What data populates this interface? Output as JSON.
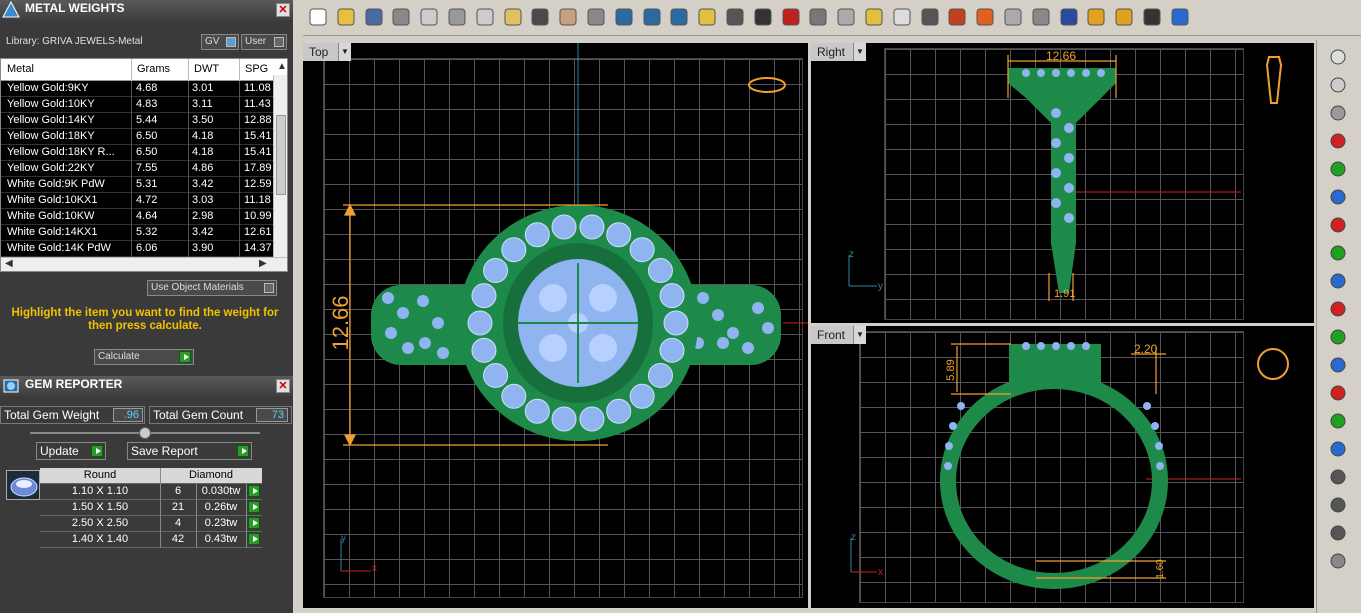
{
  "metal_weights": {
    "title": "METAL WEIGHTS",
    "library": "Library: GRIVA JEWELS-Metal",
    "gv_label": "GV",
    "user_label": "User",
    "columns": [
      "Metal",
      "Grams",
      "DWT",
      "SPG"
    ],
    "rows": [
      [
        "Yellow Gold:9KY",
        "4.68",
        "3.01",
        "11.08"
      ],
      [
        "Yellow Gold:10KY",
        "4.83",
        "3.11",
        "11.43"
      ],
      [
        "Yellow Gold:14KY",
        "5.44",
        "3.50",
        "12.88"
      ],
      [
        "Yellow Gold:18KY",
        "6.50",
        "4.18",
        "15.41"
      ],
      [
        "Yellow Gold:18KY R...",
        "6.50",
        "4.18",
        "15.41"
      ],
      [
        "Yellow Gold:22KY",
        "7.55",
        "4.86",
        "17.89"
      ],
      [
        "White Gold:9K PdW",
        "5.31",
        "3.42",
        "12.59"
      ],
      [
        "White Gold:10KX1",
        "4.72",
        "3.03",
        "11.18"
      ],
      [
        "White Gold:10KW",
        "4.64",
        "2.98",
        "10.99"
      ],
      [
        "White Gold:14KX1",
        "5.32",
        "3.42",
        "12.61"
      ],
      [
        "White Gold:14K PdW",
        "6.06",
        "3.90",
        "14.37"
      ]
    ],
    "use_object_materials": "Use Object Materials",
    "hint": "Highlight the item you want to find the weight for then press calculate.",
    "calculate_label": "Calculate"
  },
  "gem_reporter": {
    "title": "GEM REPORTER",
    "total_weight_label": "Total Gem Weight",
    "total_weight_value": ".96",
    "total_count_label": "Total Gem Count",
    "total_count_value": "73",
    "update_label": "Update",
    "save_report_label": "Save Report",
    "shape_header": "Round",
    "material_header": "Diamond",
    "rows": [
      [
        "1.10 X 1.10",
        "6",
        "0.030tw"
      ],
      [
        "1.50 X 1.50",
        "21",
        "0.26tw"
      ],
      [
        "2.50 X 2.50",
        "4",
        "0.23tw"
      ],
      [
        "1.40 X 1.40",
        "42",
        "0.43tw"
      ]
    ]
  },
  "viewports": {
    "top": {
      "label": "Top",
      "dimension": "12.66",
      "axis_v": "y",
      "axis_h": "x"
    },
    "right": {
      "label": "Right",
      "dimension_top": "12.66",
      "dimension_bottom": "1.91",
      "axis_v": "z",
      "axis_h": "y"
    },
    "front": {
      "label": "Front",
      "dimension_left": "5.89",
      "dimension_right": "2.20",
      "dimension_bottom": "1.60",
      "axis_v": "z",
      "axis_h": "x"
    }
  },
  "colors": {
    "ring_green": "#1e8a4a",
    "gem_blue": "#8fb4f0",
    "dimension_orange": "#f0a030",
    "axis_red": "#d02020"
  },
  "toolbar_icons": [
    "new-file-icon",
    "open-folder-icon",
    "save-icon",
    "print-icon",
    "copy-doc-icon",
    "cut-icon",
    "copy-icon",
    "paste-icon",
    "undo-icon",
    "pan-hand-icon",
    "move-icon",
    "zoom-in-icon",
    "zoom-window-icon",
    "zoom-extents-icon",
    "zoom-icon",
    "rotate-view-icon",
    "four-views-icon",
    "car-icon",
    "plane-icon",
    "orbit-icon",
    "select-icon",
    "light-icon",
    "lock-icon",
    "layers-icon",
    "color-wheel-icon",
    "shade-icon",
    "render-icon",
    "sphere-icon",
    "paint-icon",
    "gear-icon",
    "snap-icon",
    "help-icon"
  ],
  "sidebar_icons": [
    "camera-icon",
    "light-bulb-icon",
    "sphere-icon",
    "arrow-right-icon",
    "arrow-up-icon",
    "arrow-up-blue-icon",
    "arrow-left-icon",
    "arrow-down-icon",
    "arrow-down-blue-icon",
    "expand-horizontal-icon",
    "expand-vertical-icon",
    "expand-vertical-blue-icon",
    "shrink-horizontal-icon",
    "shrink-vertical-icon",
    "shrink-vertical-blue-icon",
    "curve-icon",
    "line-icon",
    "line2-icon",
    "eraser-icon"
  ]
}
